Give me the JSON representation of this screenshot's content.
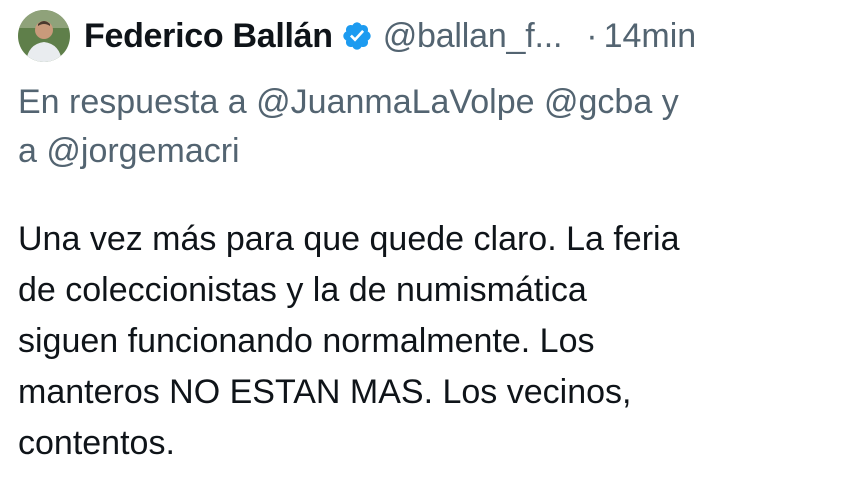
{
  "author": {
    "display_name": "Federico Ballán",
    "handle": "@ballan_f...",
    "verified_icon": "verified-badge-icon",
    "verified_color": "#1d9bf0",
    "avatar": "profile-photo"
  },
  "meta": {
    "separator": "·",
    "time": "14min"
  },
  "reply_context": {
    "prefix": "En respuesta a",
    "mention_1": "@JuanmaLaVolpe",
    "mention_2": "@gcba",
    "joiner": "y",
    "joiner_2": "a",
    "mention_3": "@jorgemacri"
  },
  "tweet": {
    "lines": [
      "Una vez más para que quede claro. La feria",
      "de coleccionistas y la de numismática",
      "siguen funcionando normalmente. Los",
      "manteros NO ESTAN MAS. Los vecinos,",
      "contentos."
    ]
  },
  "colors": {
    "text": "#0f1419",
    "secondary": "#536471",
    "background": "#ffffff"
  }
}
